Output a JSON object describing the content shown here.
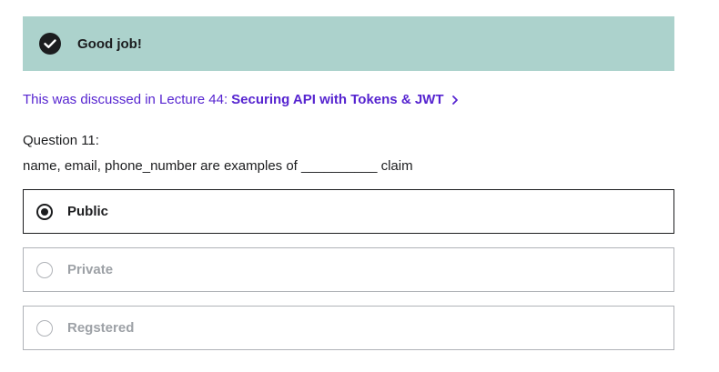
{
  "banner": {
    "icon": "check-circle-icon",
    "text": "Good job!",
    "bg_color": "#acd2cc"
  },
  "lecture": {
    "prefix": "This was discussed in Lecture 44:",
    "link_text": "Securing API with Tokens & JWT",
    "icon": "chevron-right-icon",
    "color": "#5624d0"
  },
  "question": {
    "number_label": "Question 11:",
    "text": "name, email, phone_number are examples of __________ claim"
  },
  "options": [
    {
      "label": "Public",
      "selected": true
    },
    {
      "label": "Private",
      "selected": false
    },
    {
      "label": "Regstered",
      "selected": false
    }
  ]
}
